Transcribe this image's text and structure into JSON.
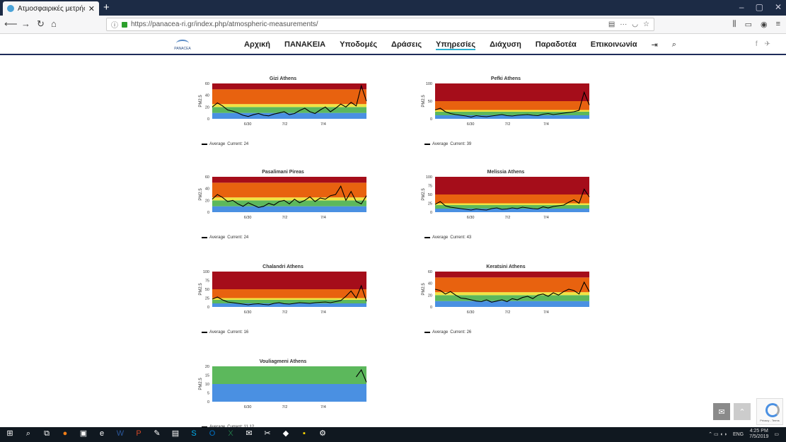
{
  "browser": {
    "tab_title": "Ατμοσφαιρικές μετρήσεις – Pa",
    "url": "https://panacea-ri.gr/index.php/atmospheric-measurements/",
    "new_tab_label": "+",
    "window_controls": [
      "–",
      "▢",
      "✕"
    ],
    "back_icon": "arrow-left-icon",
    "forward_icon": "arrow-right-icon",
    "reload_icon": "reload-icon",
    "home_icon": "home-icon",
    "url_actions": [
      "reader-view-icon",
      "more-icon",
      "pocket-icon",
      "star-icon"
    ],
    "right_toolbar": [
      "library-icon",
      "sidebar-icon",
      "account-icon",
      "menu-icon"
    ]
  },
  "site": {
    "logo_text": "PANACEA",
    "menu": [
      "Αρχική",
      "ΠΑΝΑΚΕΙΑ",
      "Υποδομές",
      "Δράσεις",
      "Υπηρεσίες",
      "Διάχυση",
      "Παραδοτέα",
      "Επικοινωνία"
    ],
    "active_menu": "Υπηρεσίες",
    "menu_icons": [
      "login-icon",
      "search-icon"
    ],
    "social": [
      "f",
      "twitter-icon"
    ]
  },
  "charts": {
    "ylabel": "PM2.5",
    "x_ticks": [
      "6/30",
      "7/2",
      "7/4"
    ],
    "legend_label": "Average",
    "current_prefix": "Current:",
    "band_colors": {
      "blue": "#4a90e2",
      "green": "#5cb85c",
      "yellow": "#f0e442",
      "orange": "#e8620f",
      "red": "#a50d1a"
    }
  },
  "chart_data": [
    {
      "type": "line",
      "title": "Gizi Athens",
      "ylim": [
        0,
        60
      ],
      "yticks": [
        0,
        20,
        40,
        60
      ],
      "current": "Current: 24",
      "bands": [
        10,
        20,
        25,
        50
      ],
      "values": [
        20,
        27,
        22,
        15,
        13,
        10,
        6,
        4,
        7,
        9,
        6,
        5,
        8,
        10,
        12,
        7,
        9,
        14,
        18,
        12,
        9,
        15,
        20,
        12,
        18,
        25,
        20,
        28,
        22,
        56,
        30
      ]
    },
    {
      "type": "line",
      "title": "Pefki Athens",
      "ylim": [
        0,
        100
      ],
      "yticks": [
        0,
        50,
        100
      ],
      "current": "Current: 39",
      "bands": [
        10,
        20,
        25,
        50
      ],
      "values": [
        25,
        30,
        20,
        15,
        12,
        10,
        8,
        5,
        9,
        7,
        6,
        8,
        10,
        12,
        9,
        8,
        10,
        11,
        12,
        10,
        9,
        13,
        15,
        12,
        14,
        16,
        18,
        20,
        24,
        75,
        39
      ]
    },
    {
      "type": "line",
      "title": "Pasalimani Pireas",
      "ylim": [
        0,
        60
      ],
      "yticks": [
        0,
        20,
        40,
        60
      ],
      "current": "Current: 24",
      "bands": [
        10,
        20,
        25,
        50
      ],
      "values": [
        22,
        30,
        25,
        18,
        20,
        14,
        10,
        16,
        12,
        8,
        10,
        15,
        12,
        18,
        20,
        14,
        22,
        16,
        20,
        26,
        18,
        24,
        22,
        28,
        30,
        44,
        20,
        35,
        18,
        14,
        28
      ]
    },
    {
      "type": "line",
      "title": "Melissia Athens",
      "ylim": [
        0,
        100
      ],
      "yticks": [
        0,
        25,
        50,
        75,
        100
      ],
      "current": "Current: 43",
      "bands": [
        10,
        20,
        25,
        50
      ],
      "values": [
        22,
        30,
        18,
        14,
        12,
        10,
        8,
        6,
        9,
        7,
        6,
        10,
        12,
        8,
        9,
        12,
        10,
        14,
        12,
        10,
        9,
        15,
        12,
        16,
        18,
        20,
        28,
        35,
        25,
        65,
        43
      ]
    },
    {
      "type": "line",
      "title": "Chalandri Athens",
      "ylim": [
        0,
        100
      ],
      "yticks": [
        0,
        25,
        50,
        75,
        100
      ],
      "current": "Current: 16",
      "bands": [
        10,
        20,
        25,
        50
      ],
      "values": [
        22,
        28,
        20,
        14,
        12,
        10,
        8,
        6,
        8,
        9,
        7,
        6,
        10,
        12,
        9,
        8,
        10,
        12,
        11,
        10,
        12,
        13,
        14,
        12,
        15,
        18,
        30,
        45,
        25,
        60,
        16
      ]
    },
    {
      "type": "line",
      "title": "Keratsini Athens",
      "ylim": [
        0,
        60
      ],
      "yticks": [
        0,
        20,
        40,
        60
      ],
      "current": "Current: 26",
      "bands": [
        10,
        20,
        25,
        50
      ],
      "values": [
        30,
        28,
        22,
        26,
        20,
        15,
        14,
        12,
        10,
        9,
        12,
        8,
        10,
        12,
        9,
        14,
        12,
        16,
        18,
        14,
        20,
        22,
        18,
        24,
        20,
        26,
        30,
        28,
        22,
        42,
        26
      ]
    },
    {
      "type": "line",
      "title": "Vouliagmeni Athens",
      "ylim": [
        0,
        20
      ],
      "yticks": [
        0,
        5,
        10,
        15,
        20
      ],
      "current": "Current: 11.12",
      "bands": [
        10,
        20,
        25,
        50
      ],
      "values": [
        null,
        null,
        null,
        null,
        null,
        null,
        null,
        null,
        null,
        null,
        null,
        null,
        null,
        null,
        null,
        null,
        null,
        null,
        null,
        null,
        null,
        null,
        null,
        null,
        null,
        null,
        null,
        null,
        14,
        18,
        11
      ]
    }
  ],
  "page_controls": {
    "email_icon": "envelope-icon",
    "up_icon": "chevron-up-icon",
    "recaptcha_label": "Privacy - Terms"
  },
  "taskbar": {
    "icons": [
      "windows-icon",
      "search-icon",
      "task-view-icon",
      "firefox-icon",
      "store-icon",
      "edge-icon",
      "word-icon",
      "powerpoint-icon",
      "paint-icon",
      "files-icon",
      "skype-icon",
      "outlook-icon",
      "excel-icon",
      "mail-icon",
      "tool-icon",
      "app-icon",
      "sticky-notes-icon",
      "settings-icon"
    ],
    "tray_text": "ENG",
    "time": "4:25 PM",
    "date": "7/5/2019"
  }
}
